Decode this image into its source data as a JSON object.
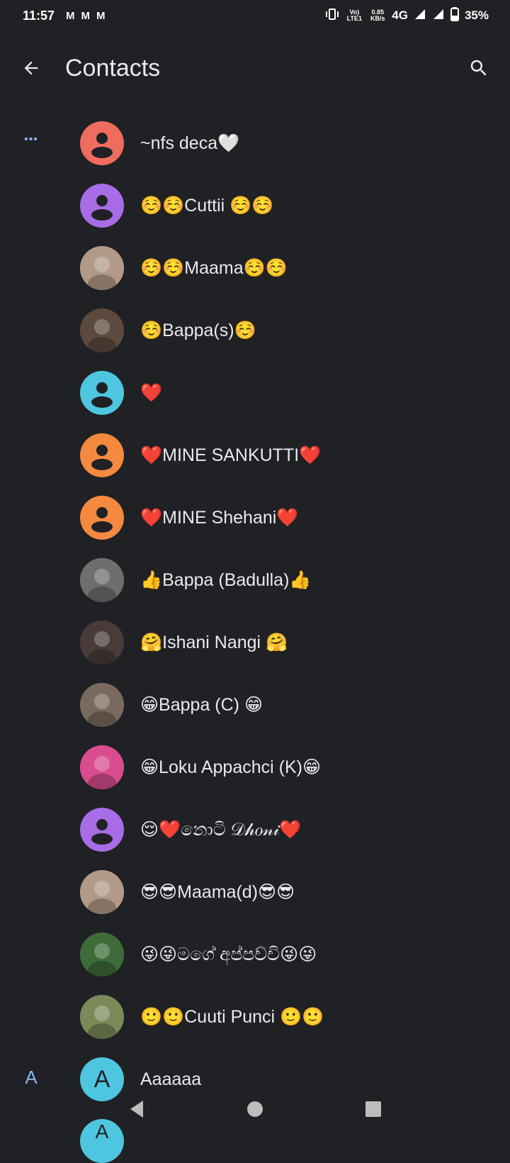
{
  "status_bar": {
    "time": "11:57",
    "mail_icons": [
      "M",
      "M",
      "M"
    ],
    "volte_label": "Vo) LTE1",
    "speed_label": "0.85 KB/s",
    "network": "4G",
    "battery": "35%"
  },
  "app_bar": {
    "title": "Contacts"
  },
  "index": {
    "favorites_marker": "•••",
    "letter_a": "A"
  },
  "contacts": [
    {
      "name": "~nfs deca🤍",
      "avatar_type": "placeholder",
      "color": "#ef6c5f"
    },
    {
      "name": "☺️☺️Cuttii ☺️☺️",
      "avatar_type": "placeholder",
      "color": "#a86ce6"
    },
    {
      "name": "☺️☺️Maama☺️☺️",
      "avatar_type": "photo",
      "color": "#b29a88"
    },
    {
      "name": "☺️Bappa(s)☺️",
      "avatar_type": "photo",
      "color": "#5c4a3f"
    },
    {
      "name": "❤️",
      "avatar_type": "placeholder",
      "color": "#4ec6df"
    },
    {
      "name": "❤️MINE SANKUTTI❤️",
      "avatar_type": "placeholder",
      "color": "#f4893f"
    },
    {
      "name": "❤️MINE Shehani❤️",
      "avatar_type": "placeholder",
      "color": "#f4893f"
    },
    {
      "name": "👍Bappa (Badulla)👍",
      "avatar_type": "photo",
      "color": "#6e6e6e"
    },
    {
      "name": "🤗Ishani Nangi 🤗",
      "avatar_type": "photo",
      "color": "#4a3b3b"
    },
    {
      "name": "😁Bappa (C) 😁",
      "avatar_type": "photo",
      "color": "#7a6a5e"
    },
    {
      "name": "😁Loku Appachci (K)😁",
      "avatar_type": "photo",
      "color": "#d94c8f"
    },
    {
      "name": "😌❤️නොටි 𝒟𝒽𝑜𝓃𝒾❤️",
      "avatar_type": "placeholder",
      "color": "#a86ce6"
    },
    {
      "name": "😎😎Maama(d)😎😎",
      "avatar_type": "photo",
      "color": "#b29a88"
    },
    {
      "name": "😜😜මගේ අප්පච්චි😜😜",
      "avatar_type": "photo",
      "color": "#3e6b3a"
    },
    {
      "name": "🙂🙂Cuuti Punci 🙂🙂",
      "avatar_type": "photo",
      "color": "#7c8a5a"
    },
    {
      "name": "Aaaaaa",
      "avatar_type": "letter",
      "letter": "A",
      "color": "#4ec6df"
    }
  ],
  "partial_next_avatar": {
    "letter": "A",
    "color": "#4ec6df"
  }
}
